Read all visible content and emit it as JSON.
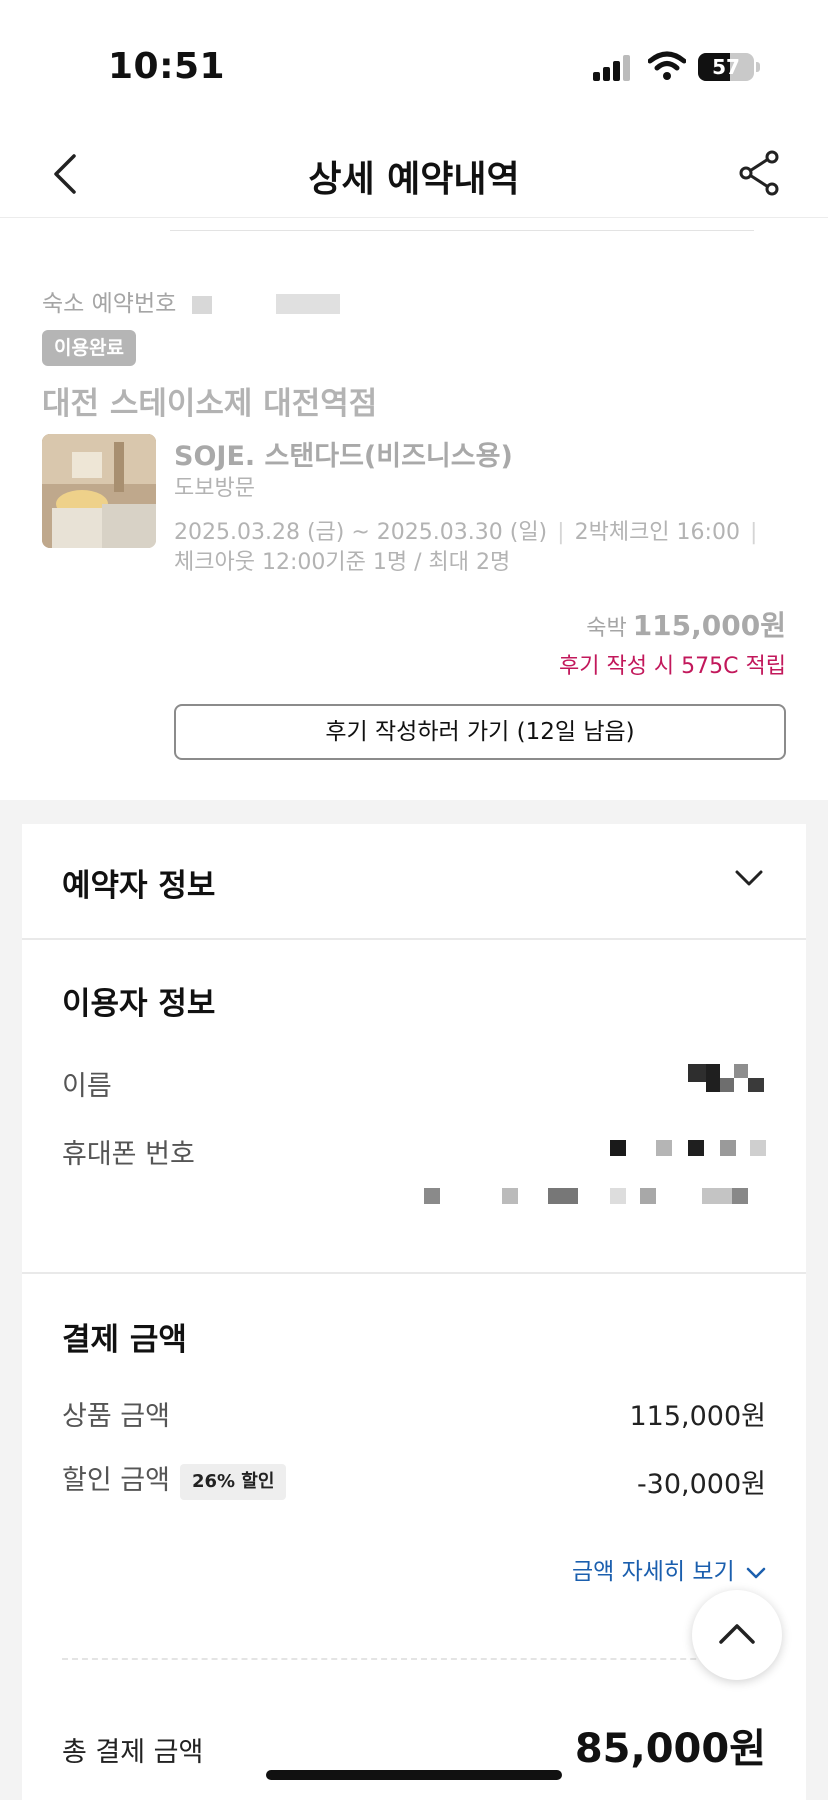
{
  "status_bar": {
    "time": "10:51",
    "battery": "57",
    "battery_level": 0.57
  },
  "header": {
    "title": "상세 예약내역",
    "back_icon": "chevron-left-icon",
    "share_icon": "share-icon"
  },
  "booking": {
    "reservation_number_label": "숙소 예약번호",
    "status_badge": "이용완료",
    "hotel_name": "대전 스테이소제 대전역점",
    "room_name": "SOJE. 스탠다드(비즈니스용)",
    "visit_type": "도보방문",
    "dates": "2025.03.28 (금) ~ 2025.03.30 (일)",
    "nights": "2박",
    "checkin": "체크인 16:00",
    "checkout": "체크아웃 12:00",
    "occupancy": "기준 1명 / 최대 2명",
    "price_label": "숙박",
    "price": "115,000원",
    "reward": "후기 작성 시 575C 적립",
    "review_button": "후기 작성하러 가기 (12일 남음)"
  },
  "booker_section": {
    "title": "예약자 정보",
    "toggle_icon": "chevron-down-icon"
  },
  "user_section": {
    "title": "이용자 정보",
    "name_label": "이름",
    "phone_label": "휴대폰 번호"
  },
  "payment": {
    "title": "결제 금액",
    "product_label": "상품 금액",
    "product_amount": "115,000원",
    "discount_label": "할인 금액",
    "discount_badge": "26% 할인",
    "discount_amount": "-30,000원",
    "detail_link": "금액 자세히 보기",
    "total_label": "총 결제 금액",
    "total_amount": "85,000원"
  },
  "colors": {
    "reward": "#c2185b",
    "link": "#1b5fae",
    "badge_done": "#b5b5b5"
  }
}
